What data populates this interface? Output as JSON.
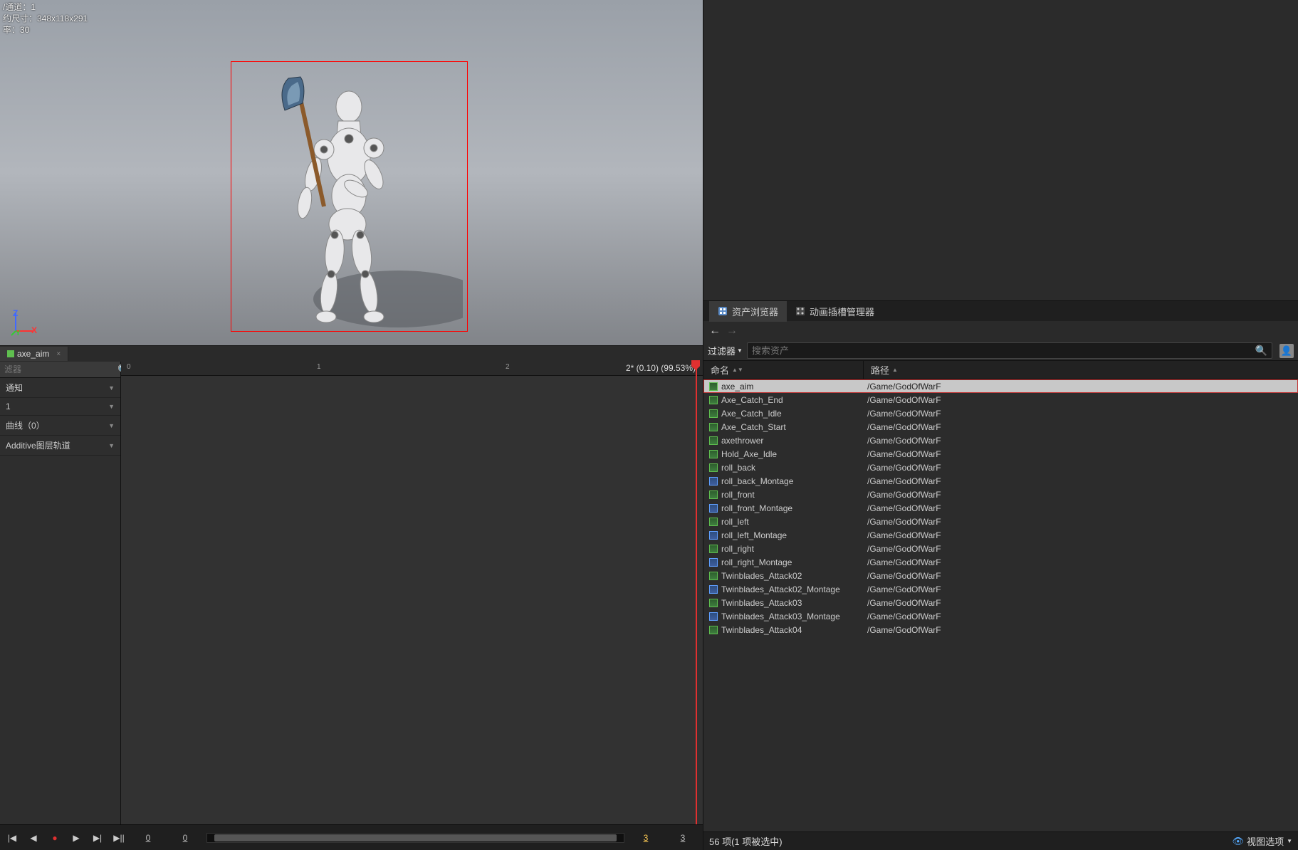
{
  "viewport": {
    "channel_line": "/通道：1",
    "approx_size_line": "约尺寸：348x118x291",
    "rate_line": "率：30",
    "axis_z": "Z",
    "axis_x": "X",
    "axis_y": "Y"
  },
  "asset_tab": {
    "name": "axe_aim",
    "close": "×"
  },
  "track_sidebar": {
    "filter_label": "滤器",
    "unsaved": "2*",
    "items": [
      {
        "label": "通知"
      },
      {
        "label": "1"
      },
      {
        "label": "曲线（0）"
      },
      {
        "label": "Additive图层轨道"
      }
    ]
  },
  "timeline": {
    "ticks": [
      "0",
      "1",
      "2"
    ],
    "overlay": "2* (0.10) (99.53%)"
  },
  "transport": {
    "frames": [
      "0",
      "0",
      "3",
      "3"
    ]
  },
  "right_tabs": {
    "asset_browser": "资产浏览器",
    "slot_manager": "动画插槽管理器"
  },
  "browser": {
    "nav_back": "←",
    "nav_fwd": "→",
    "filter_label": "过滤器",
    "search_placeholder": "搜索资产",
    "col_name": "命名",
    "col_path": "路径",
    "assets": [
      {
        "name": "axe_aim",
        "path": "/Game/GodOfWarF",
        "type": "green",
        "selected": true
      },
      {
        "name": "Axe_Catch_End",
        "path": "/Game/GodOfWarF",
        "type": "green"
      },
      {
        "name": "Axe_Catch_Idle",
        "path": "/Game/GodOfWarF",
        "type": "green"
      },
      {
        "name": "Axe_Catch_Start",
        "path": "/Game/GodOfWarF",
        "type": "green"
      },
      {
        "name": "axethrower",
        "path": "/Game/GodOfWarF",
        "type": "green"
      },
      {
        "name": "Hold_Axe_Idle",
        "path": "/Game/GodOfWarF",
        "type": "green"
      },
      {
        "name": "roll_back",
        "path": "/Game/GodOfWarF",
        "type": "green"
      },
      {
        "name": "roll_back_Montage",
        "path": "/Game/GodOfWarF",
        "type": "blue"
      },
      {
        "name": "roll_front",
        "path": "/Game/GodOfWarF",
        "type": "green"
      },
      {
        "name": "roll_front_Montage",
        "path": "/Game/GodOfWarF",
        "type": "blue"
      },
      {
        "name": "roll_left",
        "path": "/Game/GodOfWarF",
        "type": "green"
      },
      {
        "name": "roll_left_Montage",
        "path": "/Game/GodOfWarF",
        "type": "blue"
      },
      {
        "name": "roll_right",
        "path": "/Game/GodOfWarF",
        "type": "green"
      },
      {
        "name": "roll_right_Montage",
        "path": "/Game/GodOfWarF",
        "type": "blue"
      },
      {
        "name": "Twinblades_Attack02",
        "path": "/Game/GodOfWarF",
        "type": "green"
      },
      {
        "name": "Twinblades_Attack02_Montage",
        "path": "/Game/GodOfWarF",
        "type": "blue"
      },
      {
        "name": "Twinblades_Attack03",
        "path": "/Game/GodOfWarF",
        "type": "green"
      },
      {
        "name": "Twinblades_Attack03_Montage",
        "path": "/Game/GodOfWarF",
        "type": "blue"
      },
      {
        "name": "Twinblades_Attack04",
        "path": "/Game/GodOfWarF",
        "type": "green"
      }
    ],
    "status": "56 项(1 项被选中)",
    "view_options": "视图选项"
  }
}
